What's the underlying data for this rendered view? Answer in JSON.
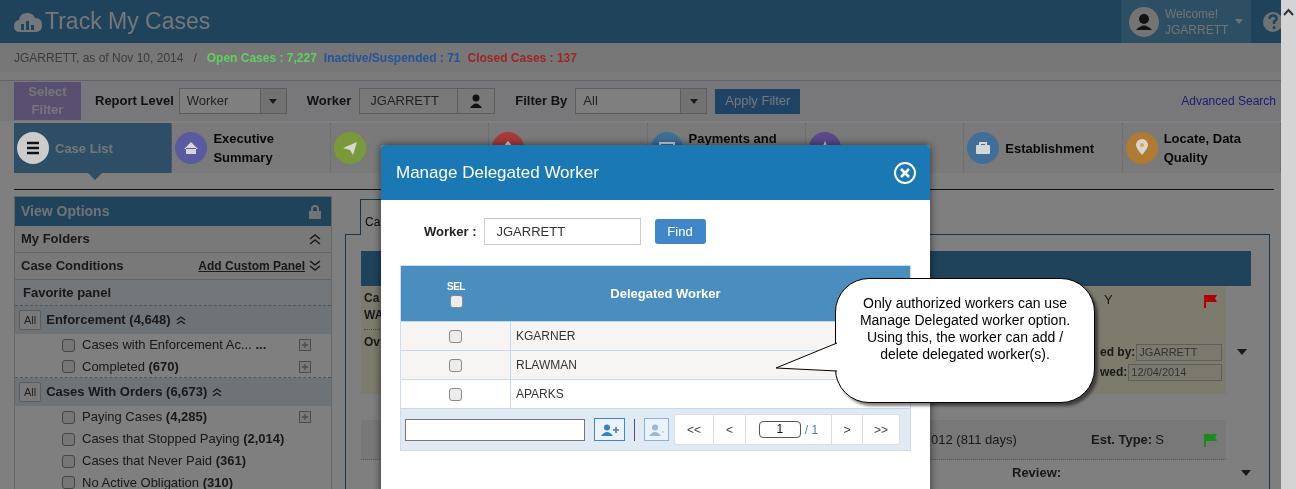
{
  "app": {
    "title": "Track My Cases"
  },
  "user": {
    "greeting": "Welcome!",
    "name": "JGARRETT"
  },
  "summary": {
    "as_of": "JGARRETT, as of Nov 10, 2014",
    "separator": "/",
    "stats": [
      {
        "label": "Open Cases : 7,227",
        "color": "#60d060"
      },
      {
        "label": "Inactive/Suspended : 71",
        "color": "#23559a"
      },
      {
        "label": "Closed Cases : 137",
        "color": "#a02525"
      }
    ]
  },
  "filter_bar": {
    "select_filter": "Select Filter",
    "report_level_label": "Report Level",
    "report_level": "Worker",
    "worker_label": "Worker",
    "worker": "JGARRETT",
    "filter_by_label": "Filter By",
    "filter_by": "All",
    "apply": "Apply Filter",
    "advanced_search": "Advanced Search"
  },
  "nav_tiles": [
    {
      "label": "Case List",
      "color": "#cccccc",
      "selected": true
    },
    {
      "label": "Executive Summary",
      "color": "#5a5aa0",
      "selected": false
    },
    {
      "color": "#7a9a3a",
      "selected": false
    },
    {
      "color": "#a83a3a",
      "selected": false
    },
    {
      "label": "Payments and",
      "color": "#3f6f96",
      "selected": false
    },
    {
      "color": "#5a4a8a",
      "selected": false
    },
    {
      "label": "Establishment",
      "color": "#3f6f96",
      "selected": false
    },
    {
      "label": "Locate, Data Quality",
      "color": "#b07a30",
      "selected": false
    }
  ],
  "view_options": {
    "title": "View Options",
    "sections": [
      {
        "label": "My Folders",
        "expanded": true
      },
      {
        "label": "Case Conditions",
        "link": "Add Custom Panel",
        "expanded": false
      }
    ],
    "favorite_panel": "Favorite panel",
    "groups": [
      {
        "all": "All",
        "label": "Enforcement (4,648)",
        "expanded": true,
        "items": [
          {
            "label": "Cases with Enforcement Ac... **...**",
            "checked": false,
            "addable": true
          },
          {
            "label": "Completed **(670)**",
            "checked": false,
            "addable": true
          }
        ]
      },
      {
        "all": "All",
        "label": "Cases With Orders (6,673)",
        "expanded": true,
        "items": [
          {
            "label": "Paying Cases **(4,285)**",
            "checked": false,
            "addable": true
          },
          {
            "label": "Cases that Stopped Paying **(2,014)**",
            "checked": false,
            "addable": false
          },
          {
            "label": "Cases that Never Paid **(361)**",
            "checked": false,
            "addable": false
          },
          {
            "label": "No Active Obligation **(310)**",
            "checked": false,
            "addable": false
          }
        ]
      }
    ]
  },
  "case_panel": {
    "tab_label": "Ca",
    "card1": {
      "left": [
        "Ca",
        "WA",
        "Ov"
      ],
      "right_top": "Y",
      "flag": {
        "color": "#b00000"
      },
      "fields": [
        {
          "label": "ed by:",
          "value": "JGARRETT"
        },
        {
          "label": "wed:",
          "value": "12/04/2014"
        }
      ]
    },
    "card2": {
      "left": "012 (811 days)",
      "est_label": "Est. Type:",
      "est_value": "S",
      "flag": {
        "color": "#1a8a1a"
      },
      "review_label": "Review:"
    }
  },
  "modal": {
    "title": "Manage Delegated Worker",
    "worker_label": "Worker :",
    "worker_value": "JGARRETT",
    "find": "Find",
    "columns": [
      "SEL",
      "Delegated Worker"
    ],
    "select_all": false,
    "rows": [
      {
        "name": "KGARNER",
        "checked": false
      },
      {
        "name": "RLAWMAN",
        "checked": false
      },
      {
        "name": "APARKS",
        "checked": false
      }
    ],
    "pager": {
      "first": "<<",
      "prev": "<",
      "page": "1",
      "total": "/ 1",
      "next": ">",
      "last": ">>"
    }
  },
  "callout": {
    "text": "Only authorized workers can use Manage Delegated worker option. Using this, the worker can add / delete delegated worker(s)."
  }
}
